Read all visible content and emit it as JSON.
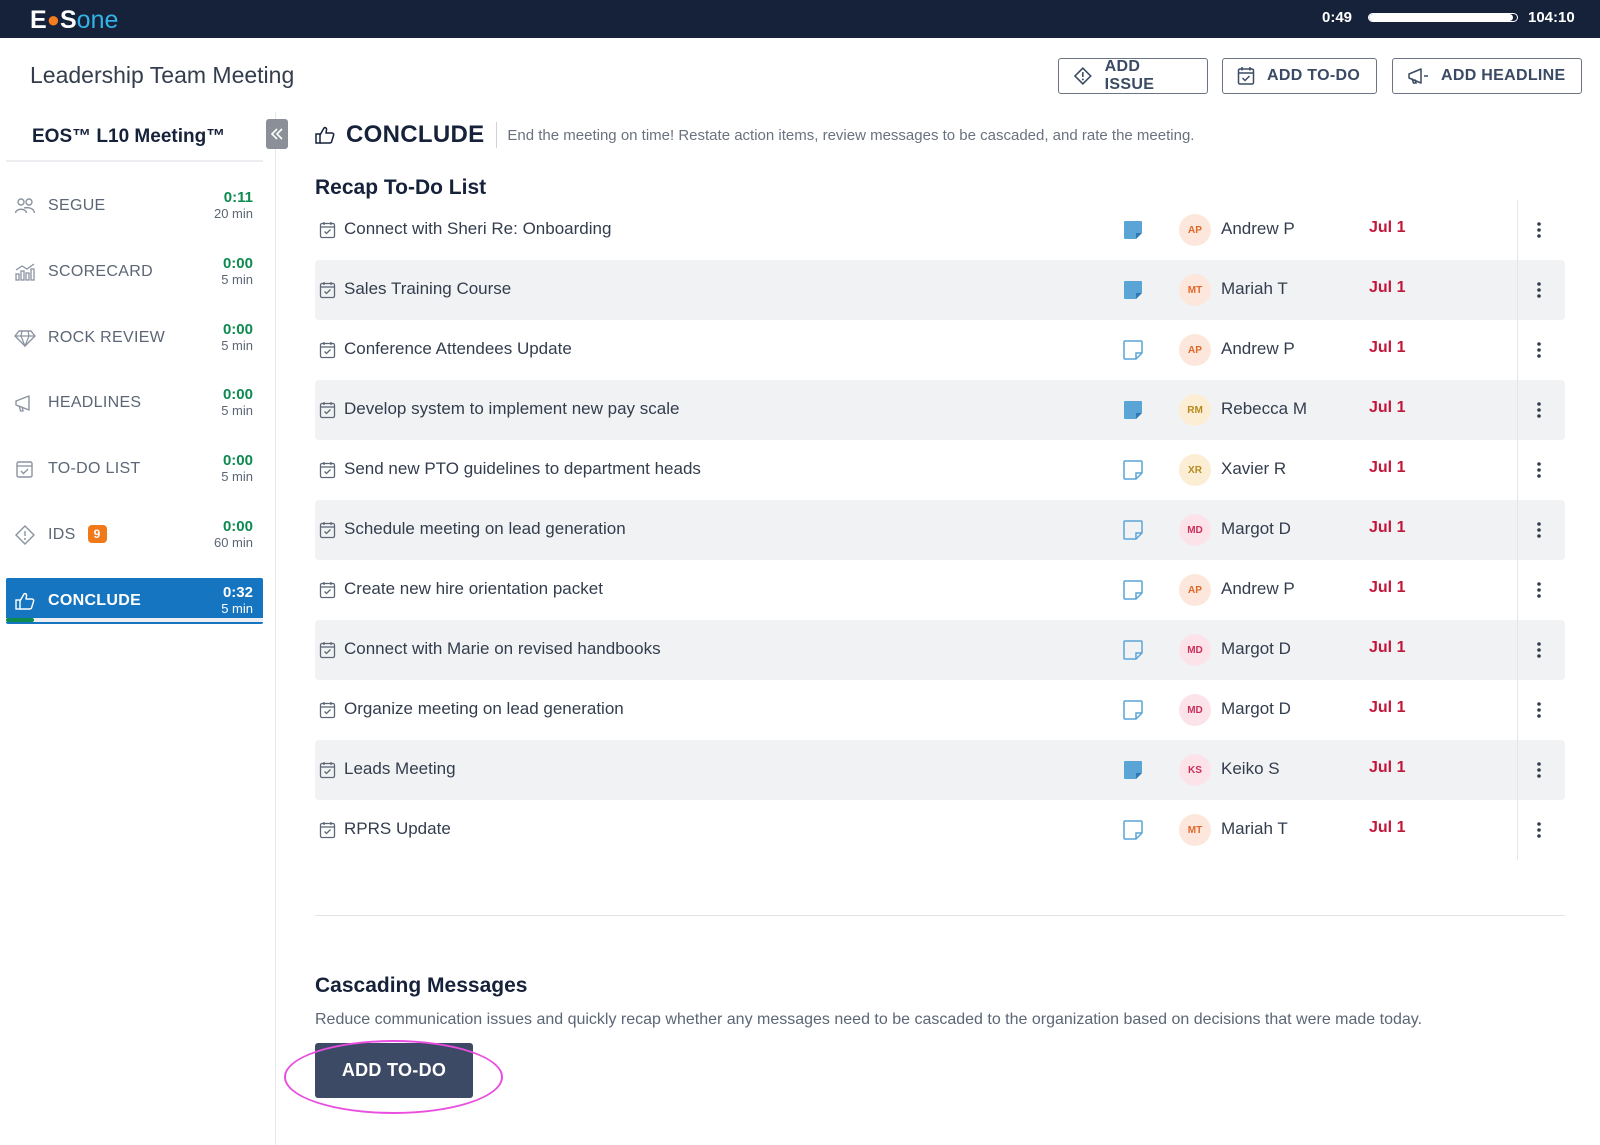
{
  "topbar": {
    "logo_eos": "E",
    "logo_dot": "●",
    "logo_s": "S",
    "logo_one": "one",
    "elapsed": "0:49",
    "total": "104:10",
    "progress_fraction": 0.97
  },
  "header": {
    "meeting_title": "Leadership Team Meeting",
    "add_issue": "ADD ISSUE",
    "add_todo": "ADD TO-DO",
    "add_headline": "ADD HEADLINE"
  },
  "sidebar": {
    "title": "EOS™ L10 Meeting™",
    "items": [
      {
        "label": "SEGUE",
        "time": "0:11",
        "duration": "20 min",
        "icon": "people-icon"
      },
      {
        "label": "SCORECARD",
        "time": "0:00",
        "duration": "5 min",
        "icon": "chart-icon"
      },
      {
        "label": "ROCK REVIEW",
        "time": "0:00",
        "duration": "5 min",
        "icon": "diamond-icon"
      },
      {
        "label": "HEADLINES",
        "time": "0:00",
        "duration": "5 min",
        "icon": "megaphone-icon"
      },
      {
        "label": "TO-DO LIST",
        "time": "0:00",
        "duration": "5 min",
        "icon": "calendar-check-icon"
      },
      {
        "label": "IDS",
        "badge": "9",
        "time": "0:00",
        "duration": "60 min",
        "icon": "diamond-alert-icon"
      },
      {
        "label": "CONCLUDE",
        "time": "0:32",
        "duration": "5 min",
        "icon": "thumbs-up-icon",
        "active": true
      }
    ],
    "active_progress_fraction": 0.11
  },
  "section": {
    "title": "CONCLUDE",
    "description": "End the meeting on time! Restate action items, review messages to be cascaded, and rate the meeting."
  },
  "recap": {
    "title": "Recap To-Do List",
    "rows": [
      {
        "text": "Connect with Sheri Re: Onboarding",
        "note_filled": true,
        "initials": "AP",
        "owner": "Andrew P",
        "due": "Jul 1"
      },
      {
        "text": "Sales Training Course",
        "note_filled": true,
        "initials": "MT",
        "owner": "Mariah T",
        "due": "Jul 1"
      },
      {
        "text": "Conference Attendees Update",
        "note_filled": false,
        "initials": "AP",
        "owner": "Andrew P",
        "due": "Jul 1"
      },
      {
        "text": "Develop system to implement new pay scale",
        "note_filled": true,
        "initials": "RM",
        "owner": "Rebecca M",
        "due": "Jul 1"
      },
      {
        "text": "Send new PTO guidelines to department heads",
        "note_filled": false,
        "initials": "XR",
        "owner": "Xavier R",
        "due": "Jul 1"
      },
      {
        "text": "Schedule meeting on lead generation",
        "note_filled": false,
        "initials": "MD",
        "owner": "Margot D",
        "due": "Jul 1"
      },
      {
        "text": "Create new hire orientation packet",
        "note_filled": false,
        "initials": "AP",
        "owner": "Andrew P",
        "due": "Jul 1"
      },
      {
        "text": "Connect with Marie on revised handbooks",
        "note_filled": false,
        "initials": "MD",
        "owner": "Margot D",
        "due": "Jul 1"
      },
      {
        "text": "Organize meeting on lead generation",
        "note_filled": false,
        "initials": "MD",
        "owner": "Margot D",
        "due": "Jul 1"
      },
      {
        "text": "Leads Meeting",
        "note_filled": true,
        "initials": "KS",
        "owner": "Keiko S",
        "due": "Jul 1"
      },
      {
        "text": "RPRS Update",
        "note_filled": false,
        "initials": "MT",
        "owner": "Mariah T",
        "due": "Jul 1"
      }
    ]
  },
  "cascading": {
    "title": "Cascading Messages",
    "description": "Reduce communication issues and quickly recap whether any messages need to be cascaded to the organization based on decisions that were made today.",
    "button": "ADD TO-DO"
  },
  "colors": {
    "topbar": "#16213a",
    "active": "#1575c0",
    "timer_green": "#0d8a4f",
    "due_red": "#c2163b",
    "highlight": "#e94ee0"
  }
}
